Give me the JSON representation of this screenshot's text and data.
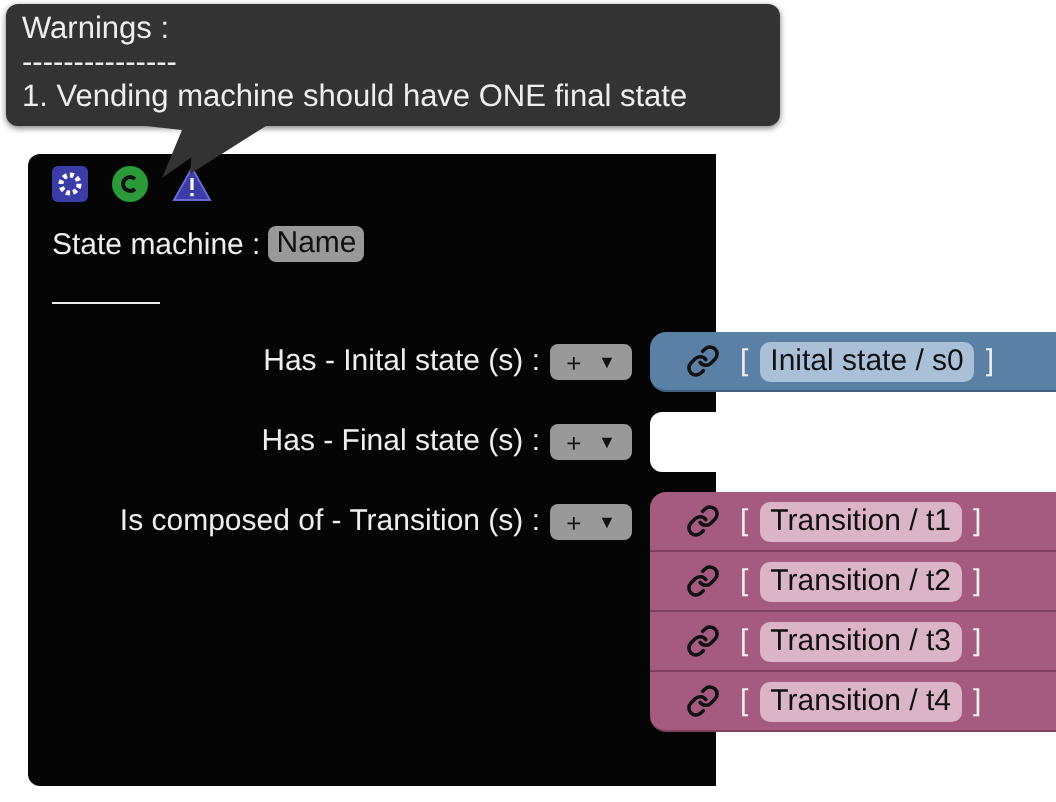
{
  "tooltip": {
    "title": "Warnings :",
    "divider": "---------------",
    "messages": [
      "1. Vending machine should have ONE final state"
    ]
  },
  "block": {
    "title": "State machine :",
    "name_field": "Name",
    "inputs": [
      {
        "label": "Has - Inital state (s) :",
        "plus": "+",
        "caret": "▼",
        "children": [
          {
            "kind": "state",
            "open": "[",
            "label": "Inital state / s0",
            "close": "]"
          }
        ]
      },
      {
        "label": "Has - Final state (s) :",
        "plus": "+",
        "caret": "▼"
      },
      {
        "label": "Is composed of - Transition (s) :",
        "plus": "+",
        "caret": "▼",
        "children": [
          {
            "kind": "transition",
            "open": "[",
            "label": "Transition / t1",
            "close": "]"
          },
          {
            "kind": "transition",
            "open": "[",
            "label": "Transition / t2",
            "close": "]"
          },
          {
            "kind": "transition",
            "open": "[",
            "label": "Transition / t3",
            "close": "]"
          },
          {
            "kind": "transition",
            "open": "[",
            "label": "Transition / t4",
            "close": "]"
          }
        ]
      }
    ]
  }
}
